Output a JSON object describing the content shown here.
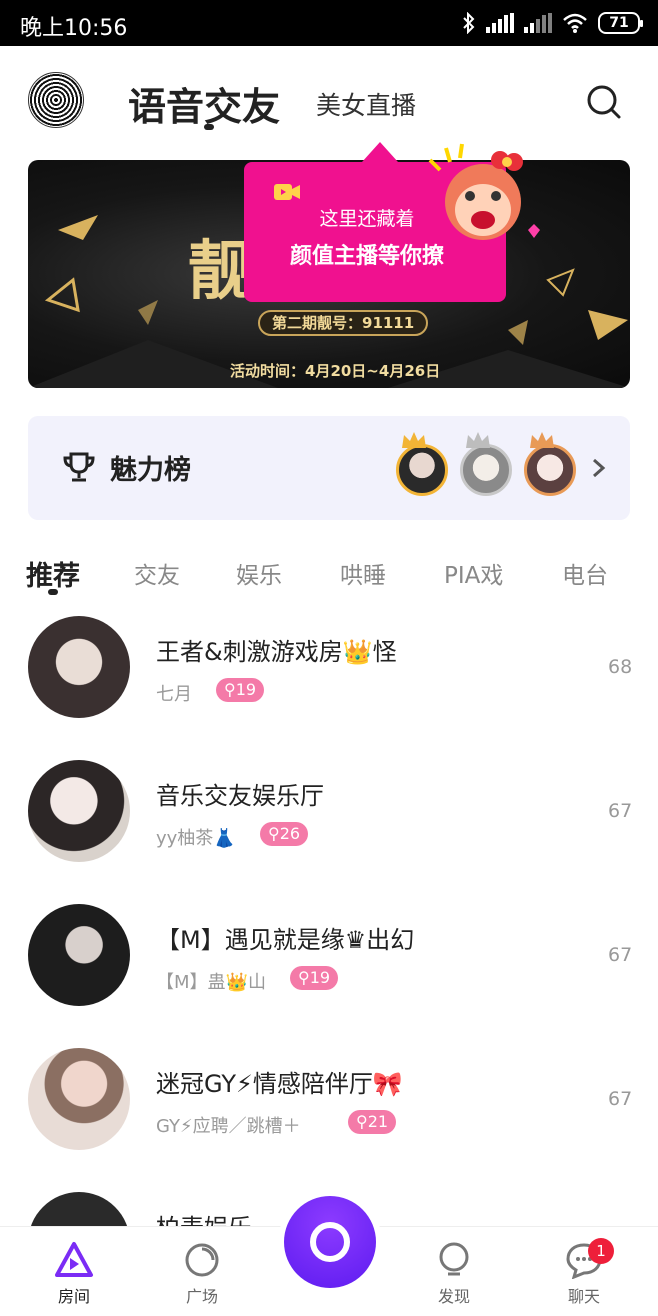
{
  "status_bar": {
    "time": "晚上10:56",
    "battery": "71"
  },
  "header": {
    "tab_main": "语音交友",
    "tab_second": "美女直播"
  },
  "banner": {
    "big_text": "靓",
    "pill": "第二期靓号：91111",
    "date": "活动时间：4月20日~4月26日",
    "tip_line1": "这里还藏着",
    "tip_line2": "颜值主播等你撩"
  },
  "charm": {
    "title": "魅力榜"
  },
  "categories": [
    "推荐",
    "交友",
    "娱乐",
    "哄睡",
    "PIA戏",
    "电台"
  ],
  "rooms": [
    {
      "title": "王者&刺激游戏房👑怪",
      "host": "七月",
      "tag": "19",
      "count": "68"
    },
    {
      "title": "音乐交友娱乐厅",
      "host": "yy柚茶👗",
      "tag": "26",
      "count": "67"
    },
    {
      "title": "【M】遇见就是缘♛出幻",
      "host": "【M】蛊👑山",
      "tag": "19",
      "count": "67"
    },
    {
      "title": "迷冠GY⚡情感陪伴厅🎀",
      "host": "GY⚡应聘／跳槽＋",
      "tag": "21",
      "count": "67"
    },
    {
      "title": "柏麦娱乐 — 冠",
      "host": "",
      "tag": "",
      "count": ""
    }
  ],
  "bottom_nav": {
    "items": [
      "房间",
      "广场",
      "发现",
      "聊天"
    ],
    "chat_badge": "1"
  },
  "colors": {
    "accent_pink": "#f0118f",
    "tag_pink": "#f47aa8",
    "accent_purple": "#6a22f5",
    "badge_red": "#ee1f3a"
  }
}
